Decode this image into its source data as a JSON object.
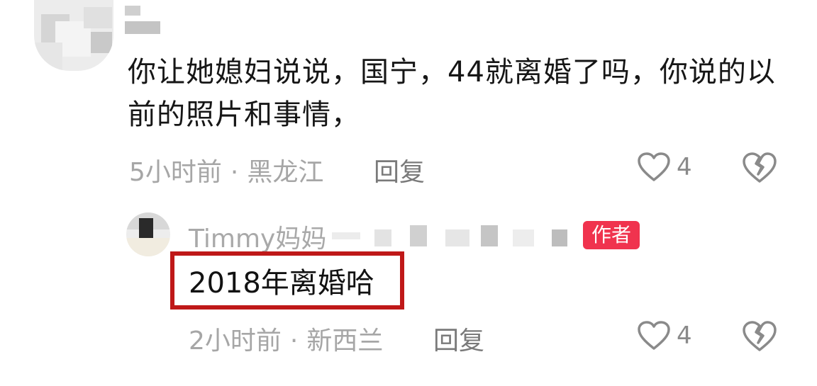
{
  "comment": {
    "text": "你让她媳妇说说，国宁，44就离婚了吗，你说的以前的照片和事情，",
    "time": "5小时前",
    "separator": "·",
    "location": "黑龙江",
    "reply_label": "回复",
    "likes": "4"
  },
  "reply": {
    "author": "Timmy妈妈",
    "author_badge": "作者",
    "text": "2018年离婚哈",
    "time": "2小时前",
    "separator": "·",
    "location": "新西兰",
    "reply_label": "回复",
    "likes": "4"
  },
  "colors": {
    "badge": "#f0334e",
    "highlight_border": "#bf1818",
    "meta_text": "#a6a6a6",
    "icon_stroke": "#8a8a8a"
  },
  "icons": {
    "like": "heart-outline-icon",
    "dislike": "broken-heart-icon"
  }
}
